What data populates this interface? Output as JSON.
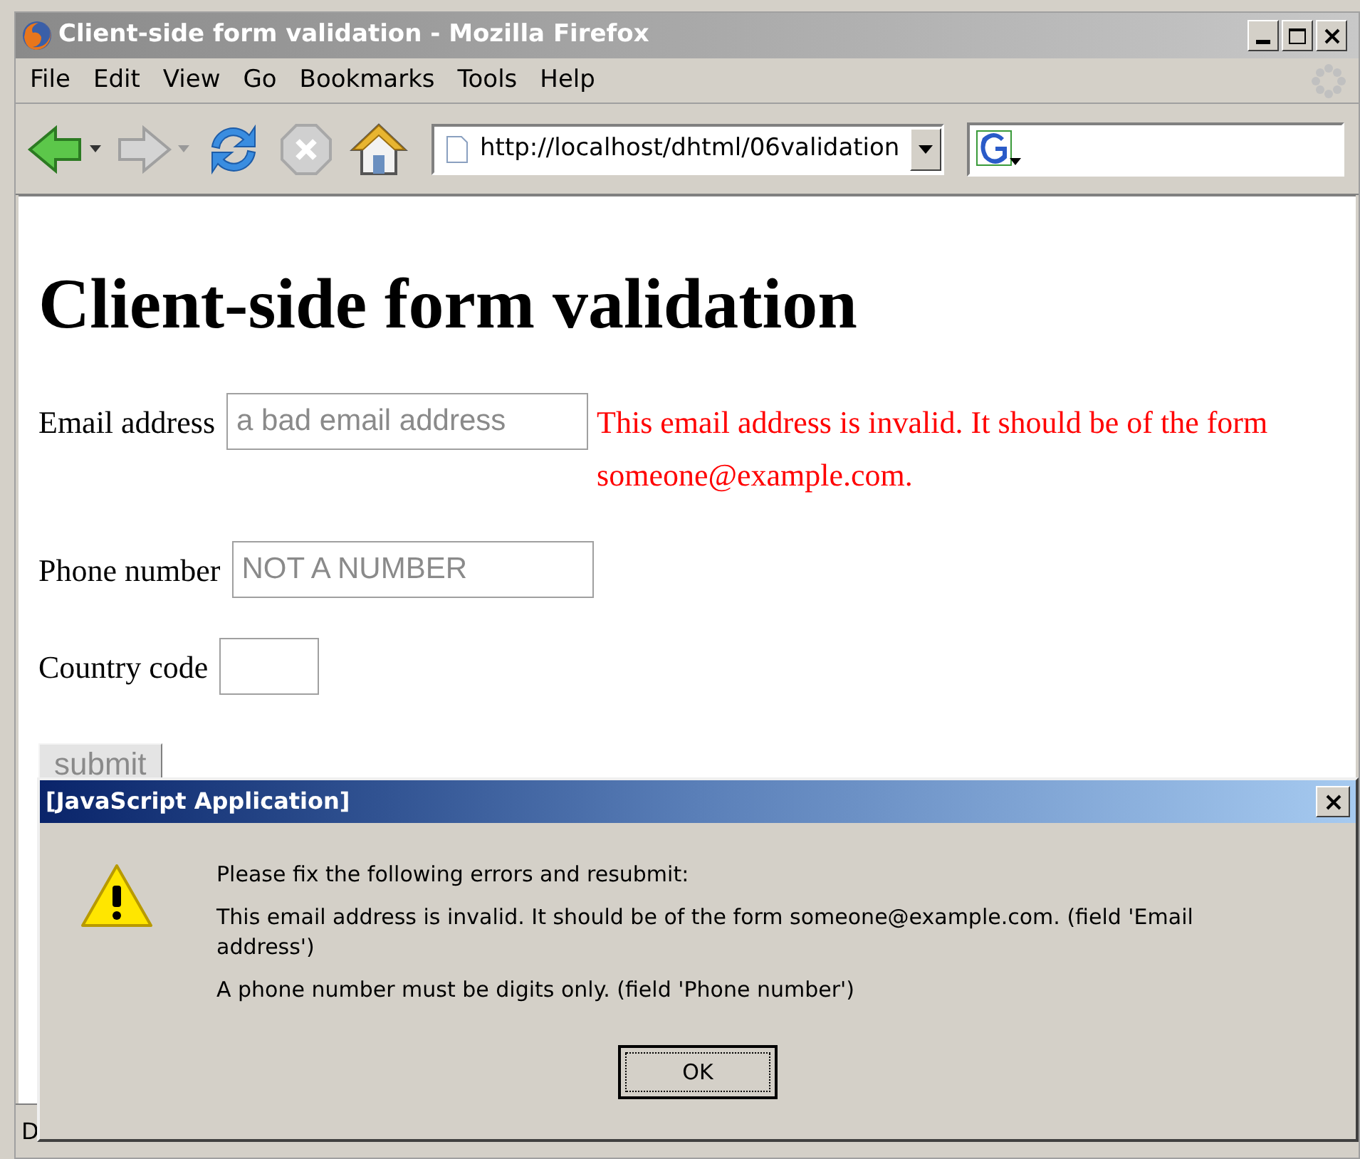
{
  "window": {
    "title": "Client-side form validation - Mozilla Firefox"
  },
  "menu": [
    "File",
    "Edit",
    "View",
    "Go",
    "Bookmarks",
    "Tools",
    "Help"
  ],
  "address_bar": {
    "value": "http://localhost/dhtml/06validation"
  },
  "page": {
    "heading": "Client-side form validation",
    "fields": [
      {
        "label": "Email address",
        "value": "a bad email address",
        "disabled": true,
        "error": "This email address is invalid. It should be of the form someone@example.com."
      },
      {
        "label": "Phone number",
        "value": "NOT A NUMBER",
        "disabled": true
      },
      {
        "label": "Country code",
        "disabled": true
      }
    ],
    "submit": {
      "label": "submit",
      "disabled": true
    }
  },
  "status_bar": {
    "text": "D"
  },
  "dialog": {
    "title": "[JavaScript Application]",
    "messages": [
      "Please fix the following errors and resubmit:",
      "This email address is invalid. It should be of the form someone@example.com. (field 'Email address')",
      "A phone number must be digits only. (field 'Phone number')"
    ],
    "button": "OK"
  }
}
